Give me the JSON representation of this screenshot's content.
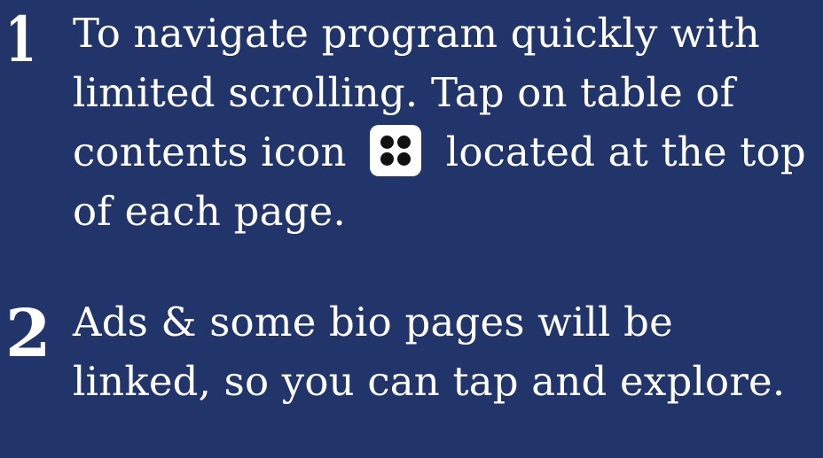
{
  "steps": [
    {
      "number": "1",
      "text_before_icon": "To navigate program quickly with limited scrolling. Tap on table of contents icon",
      "icon": "table-of-contents-icon",
      "text_after_icon": "located at the top of each page."
    },
    {
      "number": "2",
      "text": "Ads & some bio pages will be linked, so you can tap and explore."
    }
  ],
  "colors": {
    "background": "#22356b",
    "text": "#ffffff",
    "icon_background": "#ffffff",
    "icon_dots": "#111111"
  }
}
